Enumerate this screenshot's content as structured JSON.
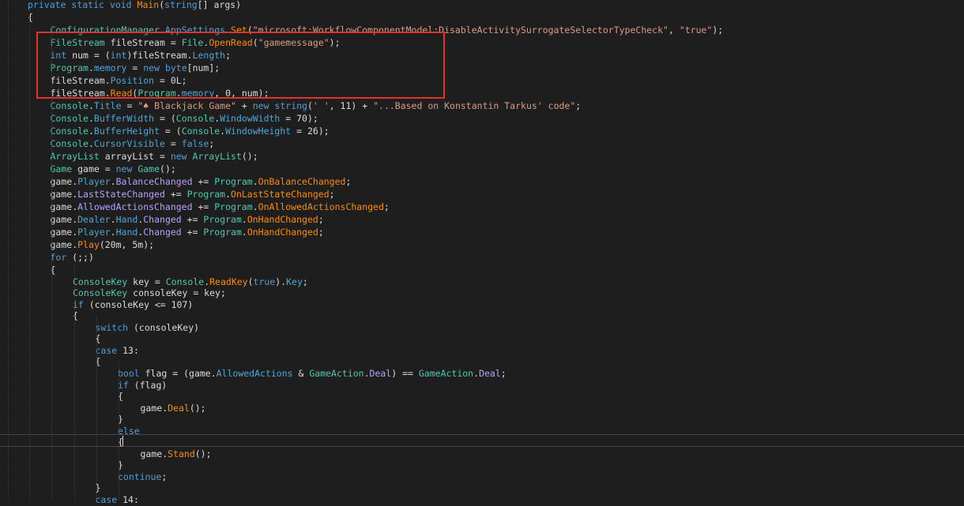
{
  "editor": {
    "lines": [
      {
        "indent": 0,
        "tokens": [
          [
            "kw",
            "private"
          ],
          [
            "tx",
            " "
          ],
          [
            "kw",
            "static"
          ],
          [
            "tx",
            " "
          ],
          [
            "kw",
            "void"
          ],
          [
            "tx",
            " "
          ],
          [
            "me",
            "Main"
          ],
          [
            "tx",
            "("
          ],
          [
            "kw",
            "string"
          ],
          [
            "tx",
            "[] "
          ],
          [
            "tx",
            "args)"
          ]
        ]
      },
      {
        "indent": 0,
        "tokens": [
          [
            "tx",
            "{"
          ]
        ]
      },
      {
        "indent": 1,
        "tokens": [
          [
            "ty",
            "ConfigurationManager"
          ],
          [
            "tx",
            "."
          ],
          [
            "pr",
            "AppSettings"
          ],
          [
            "tx",
            "."
          ],
          [
            "me",
            "Set"
          ],
          [
            "tx",
            "("
          ],
          [
            "st",
            "\"microsoft:WorkflowComponentModel:DisableActivitySurrogateSelectorTypeCheck\""
          ],
          [
            "tx",
            ", "
          ],
          [
            "st",
            "\"true\""
          ],
          [
            "tx",
            ");"
          ]
        ]
      },
      {
        "indent": 1,
        "tokens": [
          [
            "ty",
            "FileStream"
          ],
          [
            "tx",
            " fileStream = "
          ],
          [
            "ty",
            "File"
          ],
          [
            "tx",
            "."
          ],
          [
            "me",
            "OpenRead"
          ],
          [
            "tx",
            "("
          ],
          [
            "st",
            "\"gamemessage\""
          ],
          [
            "tx",
            ");"
          ]
        ]
      },
      {
        "indent": 1,
        "tokens": [
          [
            "kw",
            "int"
          ],
          [
            "tx",
            " num = ("
          ],
          [
            "kw",
            "int"
          ],
          [
            "tx",
            ")fileStream."
          ],
          [
            "pr",
            "Length"
          ],
          [
            "tx",
            ";"
          ]
        ]
      },
      {
        "indent": 1,
        "tokens": [
          [
            "ty",
            "Program"
          ],
          [
            "tx",
            "."
          ],
          [
            "pr",
            "memory"
          ],
          [
            "tx",
            " = "
          ],
          [
            "kw",
            "new"
          ],
          [
            "tx",
            " "
          ],
          [
            "kw",
            "byte"
          ],
          [
            "tx",
            "[num];"
          ]
        ]
      },
      {
        "indent": 1,
        "tokens": [
          [
            "tx",
            "fileStream."
          ],
          [
            "pr",
            "Position"
          ],
          [
            "tx",
            " = 0L;"
          ]
        ]
      },
      {
        "indent": 1,
        "tokens": [
          [
            "tx",
            "fileStream."
          ],
          [
            "me",
            "Read"
          ],
          [
            "tx",
            "("
          ],
          [
            "ty",
            "Program"
          ],
          [
            "tx",
            "."
          ],
          [
            "pr",
            "memory"
          ],
          [
            "tx",
            ", 0, num);"
          ]
        ]
      },
      {
        "indent": 1,
        "tokens": [
          [
            "ty",
            "Console"
          ],
          [
            "tx",
            "."
          ],
          [
            "pr",
            "Title"
          ],
          [
            "tx",
            " = "
          ],
          [
            "st",
            "\"♠ Blackjack Game\""
          ],
          [
            "tx",
            " + "
          ],
          [
            "kw",
            "new"
          ],
          [
            "tx",
            " "
          ],
          [
            "kw",
            "string"
          ],
          [
            "tx",
            "("
          ],
          [
            "st",
            "' '"
          ],
          [
            "tx",
            ", 11) + "
          ],
          [
            "st",
            "\"...Based on Konstantin Tarkus' code\""
          ],
          [
            "tx",
            ";"
          ]
        ]
      },
      {
        "indent": 1,
        "tokens": [
          [
            "ty",
            "Console"
          ],
          [
            "tx",
            "."
          ],
          [
            "pr",
            "BufferWidth"
          ],
          [
            "tx",
            " = ("
          ],
          [
            "ty",
            "Console"
          ],
          [
            "tx",
            "."
          ],
          [
            "pr",
            "WindowWidth"
          ],
          [
            "tx",
            " = 70);"
          ]
        ]
      },
      {
        "indent": 1,
        "tokens": [
          [
            "ty",
            "Console"
          ],
          [
            "tx",
            "."
          ],
          [
            "pr",
            "BufferHeight"
          ],
          [
            "tx",
            " = ("
          ],
          [
            "ty",
            "Console"
          ],
          [
            "tx",
            "."
          ],
          [
            "pr",
            "WindowHeight"
          ],
          [
            "tx",
            " = 26);"
          ]
        ]
      },
      {
        "indent": 1,
        "tokens": [
          [
            "ty",
            "Console"
          ],
          [
            "tx",
            "."
          ],
          [
            "pr",
            "CursorVisible"
          ],
          [
            "tx",
            " = "
          ],
          [
            "kw",
            "false"
          ],
          [
            "tx",
            ";"
          ]
        ]
      },
      {
        "indent": 1,
        "tokens": [
          [
            "ty",
            "ArrayList"
          ],
          [
            "tx",
            " arrayList = "
          ],
          [
            "kw",
            "new"
          ],
          [
            "tx",
            " "
          ],
          [
            "ty",
            "ArrayList"
          ],
          [
            "tx",
            "();"
          ]
        ]
      },
      {
        "indent": 1,
        "tokens": [
          [
            "ty",
            "Game"
          ],
          [
            "tx",
            " game = "
          ],
          [
            "kw",
            "new"
          ],
          [
            "tx",
            " "
          ],
          [
            "ty",
            "Game"
          ],
          [
            "tx",
            "();"
          ]
        ]
      },
      {
        "indent": 1,
        "tokens": [
          [
            "tx",
            "game."
          ],
          [
            "pr",
            "Player"
          ],
          [
            "tx",
            "."
          ],
          [
            "pm",
            "BalanceChanged"
          ],
          [
            "tx",
            " += "
          ],
          [
            "ty",
            "Program"
          ],
          [
            "tx",
            "."
          ],
          [
            "me",
            "OnBalanceChanged"
          ],
          [
            "tx",
            ";"
          ]
        ]
      },
      {
        "indent": 1,
        "tokens": [
          [
            "tx",
            "game."
          ],
          [
            "pm",
            "LastStateChanged"
          ],
          [
            "tx",
            " += "
          ],
          [
            "ty",
            "Program"
          ],
          [
            "tx",
            "."
          ],
          [
            "me",
            "OnLastStateChanged"
          ],
          [
            "tx",
            ";"
          ]
        ]
      },
      {
        "indent": 1,
        "tokens": [
          [
            "tx",
            "game."
          ],
          [
            "pm",
            "AllowedActionsChanged"
          ],
          [
            "tx",
            " += "
          ],
          [
            "ty",
            "Program"
          ],
          [
            "tx",
            "."
          ],
          [
            "me",
            "OnAllowedActionsChanged"
          ],
          [
            "tx",
            ";"
          ]
        ]
      },
      {
        "indent": 1,
        "tokens": [
          [
            "tx",
            "game."
          ],
          [
            "pr",
            "Dealer"
          ],
          [
            "tx",
            "."
          ],
          [
            "pr",
            "Hand"
          ],
          [
            "tx",
            "."
          ],
          [
            "pm",
            "Changed"
          ],
          [
            "tx",
            " += "
          ],
          [
            "ty",
            "Program"
          ],
          [
            "tx",
            "."
          ],
          [
            "me",
            "OnHandChanged"
          ],
          [
            "tx",
            ";"
          ]
        ]
      },
      {
        "indent": 1,
        "tokens": [
          [
            "tx",
            "game."
          ],
          [
            "pr",
            "Player"
          ],
          [
            "tx",
            "."
          ],
          [
            "pr",
            "Hand"
          ],
          [
            "tx",
            "."
          ],
          [
            "pm",
            "Changed"
          ],
          [
            "tx",
            " += "
          ],
          [
            "ty",
            "Program"
          ],
          [
            "tx",
            "."
          ],
          [
            "me",
            "OnHandChanged"
          ],
          [
            "tx",
            ";"
          ]
        ]
      },
      {
        "indent": 1,
        "tokens": [
          [
            "tx",
            "game."
          ],
          [
            "me",
            "Play"
          ],
          [
            "tx",
            "(20m, 5m);"
          ]
        ]
      },
      {
        "indent": 1,
        "tokens": [
          [
            "kw",
            "for"
          ],
          [
            "tx",
            " (;;)"
          ]
        ]
      },
      {
        "indent": 1,
        "tokens": [
          [
            "tx",
            "{"
          ]
        ]
      },
      {
        "indent": 2,
        "tokens": [
          [
            "ty",
            "ConsoleKey"
          ],
          [
            "tx",
            " key = "
          ],
          [
            "ty",
            "Console"
          ],
          [
            "tx",
            "."
          ],
          [
            "me",
            "ReadKey"
          ],
          [
            "tx",
            "("
          ],
          [
            "kw",
            "true"
          ],
          [
            "tx",
            ")."
          ],
          [
            "pr",
            "Key"
          ],
          [
            "tx",
            ";"
          ]
        ]
      },
      {
        "indent": 2,
        "tokens": [
          [
            "ty",
            "ConsoleKey"
          ],
          [
            "tx",
            " consoleKey = key;"
          ]
        ]
      },
      {
        "indent": 2,
        "tokens": [
          [
            "kw",
            "if"
          ],
          [
            "tx",
            " (consoleKey <= 107)"
          ]
        ]
      },
      {
        "indent": 2,
        "tokens": [
          [
            "tx",
            "{"
          ]
        ]
      },
      {
        "indent": 3,
        "tokens": [
          [
            "kw",
            "switch"
          ],
          [
            "tx",
            " (consoleKey)"
          ]
        ]
      },
      {
        "indent": 3,
        "tokens": [
          [
            "tx",
            "{"
          ]
        ]
      },
      {
        "indent": 3,
        "tokens": [
          [
            "kw",
            "case"
          ],
          [
            "tx",
            " 13:"
          ]
        ]
      },
      {
        "indent": 3,
        "tokens": [
          [
            "tx",
            "{"
          ]
        ]
      },
      {
        "indent": 4,
        "tokens": [
          [
            "kw",
            "bool"
          ],
          [
            "tx",
            " flag = (game."
          ],
          [
            "pr",
            "AllowedActions"
          ],
          [
            "tx",
            " & "
          ],
          [
            "ty",
            "GameAction"
          ],
          [
            "tx",
            "."
          ],
          [
            "pm",
            "Deal"
          ],
          [
            "tx",
            ") == "
          ],
          [
            "ty",
            "GameAction"
          ],
          [
            "tx",
            "."
          ],
          [
            "pm",
            "Deal"
          ],
          [
            "tx",
            ";"
          ]
        ]
      },
      {
        "indent": 4,
        "tokens": [
          [
            "kw",
            "if"
          ],
          [
            "tx",
            " (flag)"
          ]
        ]
      },
      {
        "indent": 4,
        "tokens": [
          [
            "tx",
            "{"
          ]
        ]
      },
      {
        "indent": 5,
        "tokens": [
          [
            "tx",
            "game."
          ],
          [
            "me",
            "Deal"
          ],
          [
            "tx",
            "();"
          ]
        ]
      },
      {
        "indent": 4,
        "tokens": [
          [
            "tx",
            "}"
          ]
        ]
      },
      {
        "indent": 4,
        "tokens": [
          [
            "kw",
            "else"
          ]
        ]
      },
      {
        "indent": 4,
        "tokens": [
          [
            "tx",
            "{"
          ]
        ]
      },
      {
        "indent": 5,
        "tokens": [
          [
            "tx",
            "game."
          ],
          [
            "me",
            "Stand"
          ],
          [
            "tx",
            "();"
          ]
        ]
      },
      {
        "indent": 4,
        "tokens": [
          [
            "tx",
            "}"
          ]
        ]
      },
      {
        "indent": 4,
        "tokens": [
          [
            "kw",
            "continue"
          ],
          [
            "tx",
            ";"
          ]
        ]
      },
      {
        "indent": 3,
        "tokens": [
          [
            "tx",
            "}"
          ]
        ]
      },
      {
        "indent": 3,
        "tokens": [
          [
            "kw",
            "case"
          ],
          [
            "tx",
            " 14:"
          ]
        ]
      }
    ]
  },
  "highlight": {
    "color": "#e0332e"
  },
  "theme": {
    "background": "#1e1e1e",
    "keyword": "#569cd6",
    "type": "#4ec9b0",
    "method": "#ff8c00",
    "property": "#4ea6d6",
    "event": "#b9a1ff",
    "string": "#d69d85"
  }
}
